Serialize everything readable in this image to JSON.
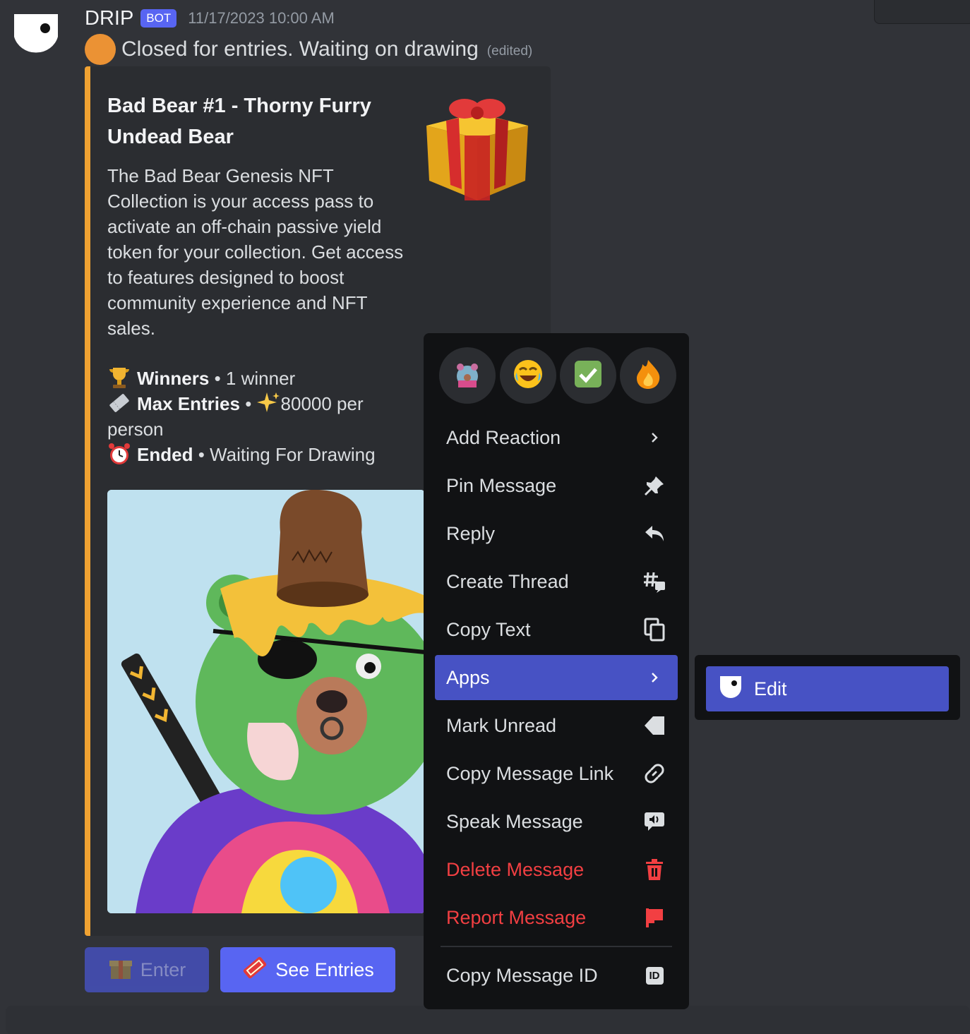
{
  "message": {
    "author": "DRIP",
    "badge": "BOT",
    "timestamp": "11/17/2023 10:00 AM",
    "status_text": "Closed for entries. Waiting on drawing",
    "edited": "(edited)"
  },
  "embed": {
    "accent_color": "#f0a232",
    "title": "Bad Bear #1 - Thorny Furry Undead Bear",
    "description": "The Bad Bear Genesis NFT Collection is your access pass to activate an off-chain passive yield token for your collection. Get access to features designed to boost community experience and NFT sales.",
    "fields": {
      "winners_label": "Winners",
      "winners_value": "1 winner",
      "max_label": "Max Entries",
      "max_value": "80000 per person",
      "ended_label": "Ended",
      "ended_value": "Waiting For Drawing"
    },
    "separator": "•"
  },
  "buttons": {
    "enter": "Enter",
    "see_entries": "See Entries"
  },
  "context_menu": {
    "quick_reactions": [
      "custom-bear-emoji",
      "joy-emoji",
      "check-mark-emoji",
      "fire-emoji"
    ],
    "items": [
      {
        "label": "Add Reaction",
        "icon": "chevron-right-icon"
      },
      {
        "label": "Pin Message",
        "icon": "pin-icon"
      },
      {
        "label": "Reply",
        "icon": "reply-icon"
      },
      {
        "label": "Create Thread",
        "icon": "thread-icon"
      },
      {
        "label": "Copy Text",
        "icon": "copy-icon"
      },
      {
        "label": "Apps",
        "icon": "chevron-right-icon"
      },
      {
        "label": "Mark Unread",
        "icon": "unread-icon"
      },
      {
        "label": "Copy Message Link",
        "icon": "link-icon"
      },
      {
        "label": "Speak Message",
        "icon": "speak-icon"
      },
      {
        "label": "Delete Message",
        "icon": "trash-icon"
      },
      {
        "label": "Report Message",
        "icon": "flag-icon"
      },
      {
        "label": "Copy Message ID",
        "icon": "id-icon",
        "icon_text": "ID"
      }
    ]
  },
  "submenu": {
    "items": [
      {
        "label": "Edit",
        "icon": "drip-app-icon"
      }
    ]
  },
  "colors": {
    "accent": "#5865f2",
    "active": "#4752c4",
    "danger": "#f23f42",
    "status_dot": "#eb9234"
  }
}
